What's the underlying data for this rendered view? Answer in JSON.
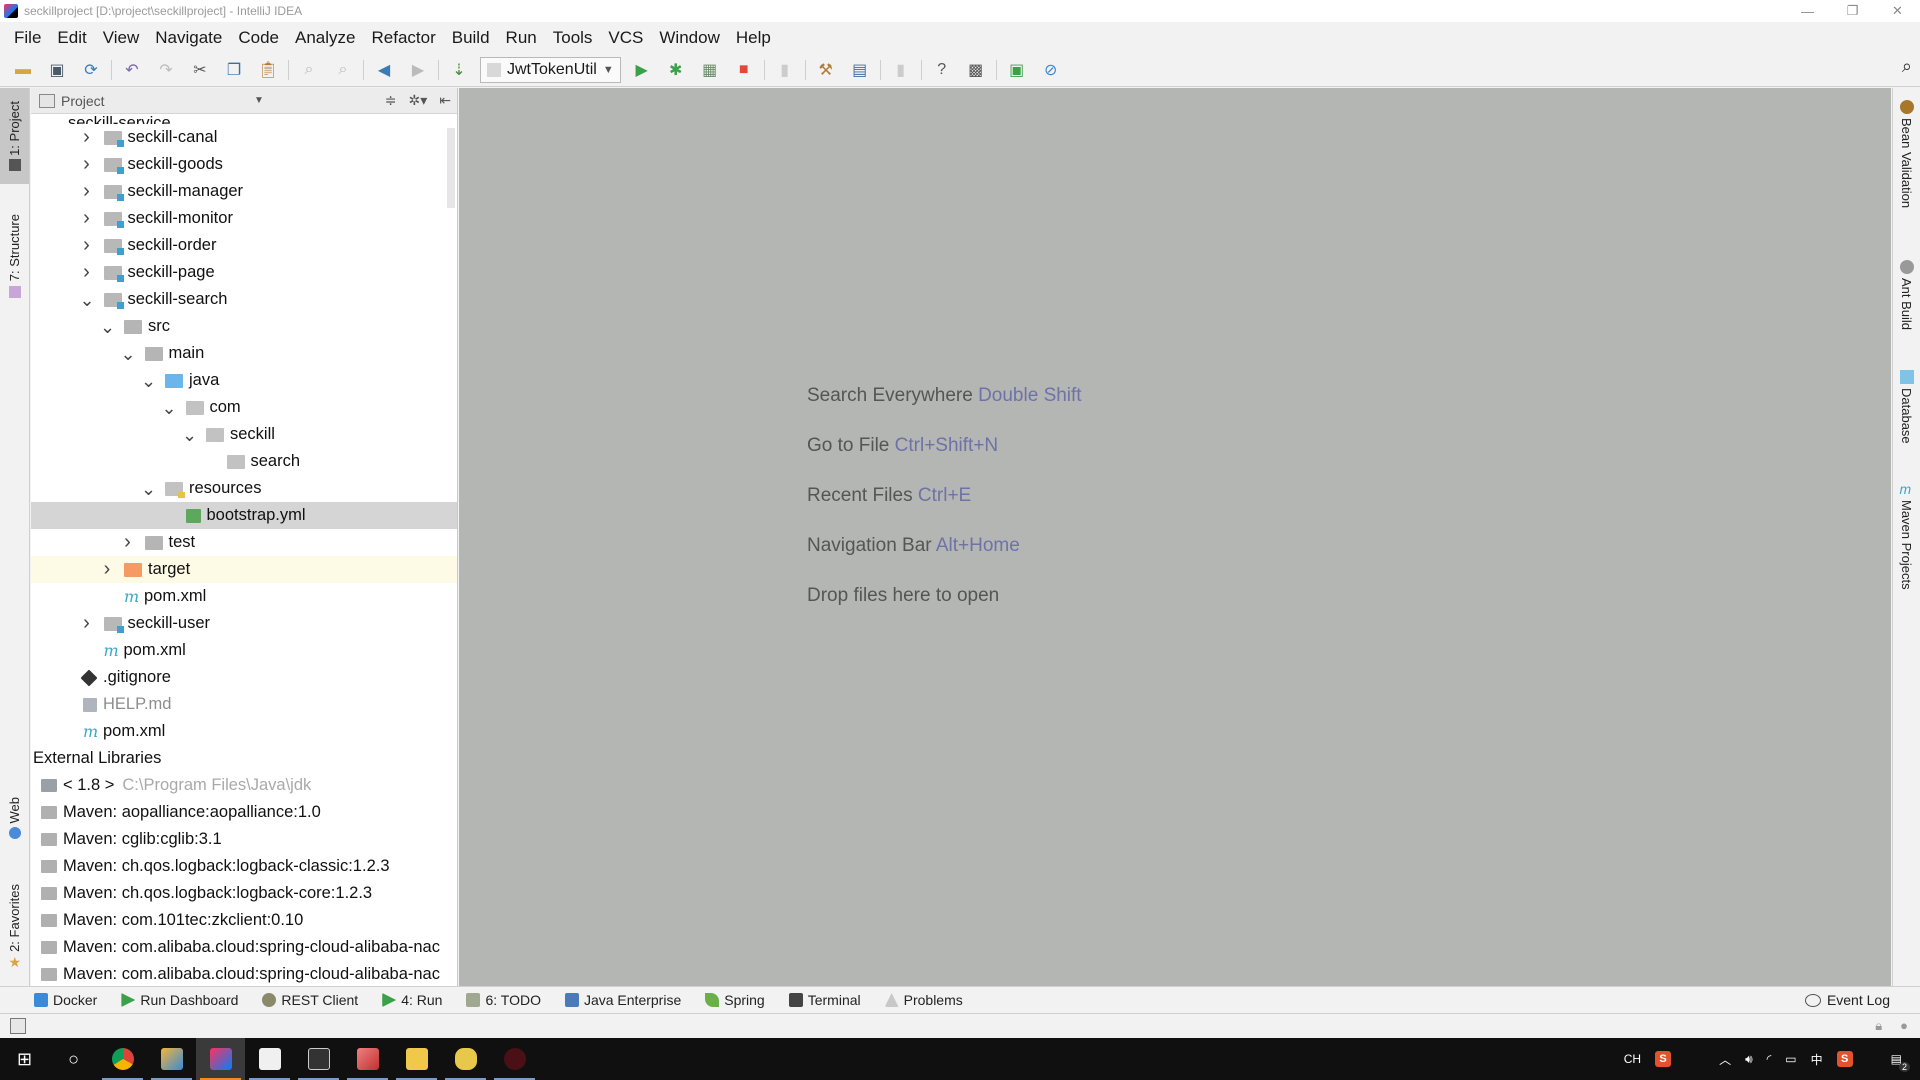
{
  "window": {
    "title": "seckillproject [D:\\project\\seckillproject] - IntelliJ IDEA",
    "controls": {
      "minimize": "—",
      "restore": "❐",
      "close": "✕"
    }
  },
  "menu": [
    "File",
    "Edit",
    "View",
    "Navigate",
    "Code",
    "Analyze",
    "Refactor",
    "Build",
    "Run",
    "Tools",
    "VCS",
    "Window",
    "Help"
  ],
  "toolbar": {
    "run_config": "JwtTokenUtil",
    "icons": {
      "open": "folder-open-icon",
      "save": "save-icon",
      "sync": "sync-icon",
      "undo": "undo-icon",
      "redo": "redo-icon",
      "cut": "cut-icon",
      "copy": "copy-icon",
      "paste": "paste-icon",
      "find": "find-icon",
      "replace": "replace-icon",
      "back": "back-icon",
      "forward": "forward-icon",
      "build": "build-icon",
      "run": "run-icon",
      "debug": "debug-icon",
      "coverage": "coverage-icon",
      "stop": "stop-icon",
      "project_structure": "project-structure-icon",
      "sdk": "sdk-icon",
      "help": "help-icon",
      "search": "search-icon"
    }
  },
  "left_tabs": [
    "1: Project",
    "7: Structure",
    "Web",
    "2: Favorites"
  ],
  "right_tabs": [
    "Bean Validation",
    "Ant Build",
    "Database",
    "Maven Projects"
  ],
  "project_panel": {
    "title": "Project",
    "partial_top_item": "seckill-service",
    "tree": [
      {
        "label": "seckill-canal",
        "level": 1,
        "icon": "module",
        "arrow": "right"
      },
      {
        "label": "seckill-goods",
        "level": 1,
        "icon": "module",
        "arrow": "right"
      },
      {
        "label": "seckill-manager",
        "level": 1,
        "icon": "module",
        "arrow": "right"
      },
      {
        "label": "seckill-monitor",
        "level": 1,
        "icon": "module",
        "arrow": "right"
      },
      {
        "label": "seckill-order",
        "level": 1,
        "icon": "module",
        "arrow": "right"
      },
      {
        "label": "seckill-page",
        "level": 1,
        "icon": "module",
        "arrow": "right"
      },
      {
        "label": "seckill-search",
        "level": 1,
        "icon": "module",
        "arrow": "down"
      },
      {
        "label": "src",
        "level": 2,
        "icon": "folder",
        "arrow": "down"
      },
      {
        "label": "main",
        "level": 3,
        "icon": "folder",
        "arrow": "down"
      },
      {
        "label": "java",
        "level": 4,
        "icon": "src-folder",
        "arrow": "down"
      },
      {
        "label": "com",
        "level": 5,
        "icon": "pkg",
        "arrow": "down"
      },
      {
        "label": "seckill",
        "level": 6,
        "icon": "pkg",
        "arrow": "down"
      },
      {
        "label": "search",
        "level": 7,
        "icon": "pkg",
        "arrow": "none"
      },
      {
        "label": "resources",
        "level": 4,
        "icon": "res",
        "arrow": "down"
      },
      {
        "label": "bootstrap.yml",
        "level": 5,
        "icon": "yml",
        "arrow": "none",
        "selected": true
      },
      {
        "label": "test",
        "level": 3,
        "icon": "folder",
        "arrow": "right"
      },
      {
        "label": "target",
        "level": 2,
        "icon": "target",
        "arrow": "right",
        "excluded": true
      },
      {
        "label": "pom.xml",
        "level": 2,
        "icon": "maven",
        "arrow": "none"
      },
      {
        "label": "seckill-user",
        "level": 1,
        "icon": "module",
        "arrow": "right"
      },
      {
        "label": "pom.xml",
        "level": 1,
        "icon": "maven",
        "arrow": "none"
      },
      {
        "label": ".gitignore",
        "level": 0,
        "icon": "git",
        "arrow": "none"
      },
      {
        "label": "HELP.md",
        "level": 0,
        "icon": "md",
        "arrow": "none",
        "muted": true
      },
      {
        "label": "pom.xml",
        "level": 0,
        "icon": "maven",
        "arrow": "none"
      }
    ],
    "external_libraries": {
      "label": "External Libraries",
      "jdk": {
        "label": "< 1.8 >",
        "path": "C:\\Program Files\\Java\\jdk"
      },
      "items": [
        "Maven: aopalliance:aopalliance:1.0",
        "Maven: cglib:cglib:3.1",
        "Maven: ch.qos.logback:logback-classic:1.2.3",
        "Maven: ch.qos.logback:logback-core:1.2.3",
        "Maven: com.101tec:zkclient:0.10",
        "Maven: com.alibaba.cloud:spring-cloud-alibaba-nac",
        "Maven: com.alibaba.cloud:spring-cloud-alibaba-nac"
      ]
    }
  },
  "editor": {
    "hints": [
      {
        "text": "Search Everywhere",
        "key": "Double Shift"
      },
      {
        "text": "Go to File",
        "key": "Ctrl+Shift+N"
      },
      {
        "text": "Recent Files",
        "key": "Ctrl+E"
      },
      {
        "text": "Navigation Bar",
        "key": "Alt+Home"
      },
      {
        "text": "Drop files here to open",
        "key": ""
      }
    ]
  },
  "bottom_tabs": [
    "Docker",
    "Run Dashboard",
    "REST Client",
    "4: Run",
    "6: TODO",
    "Java Enterprise",
    "Spring",
    "Terminal",
    "Problems"
  ],
  "event_log": "Event Log",
  "taskbar": {
    "apps": [
      "start",
      "cortana",
      "chrome",
      "toolbox",
      "intellij-idea",
      "typora",
      "terminal",
      "app-red",
      "file-explorer",
      "app-yellow",
      "app-dark-red"
    ],
    "tray": {
      "lang": "CH",
      "ime_char": "中",
      "notifications": "2"
    }
  }
}
